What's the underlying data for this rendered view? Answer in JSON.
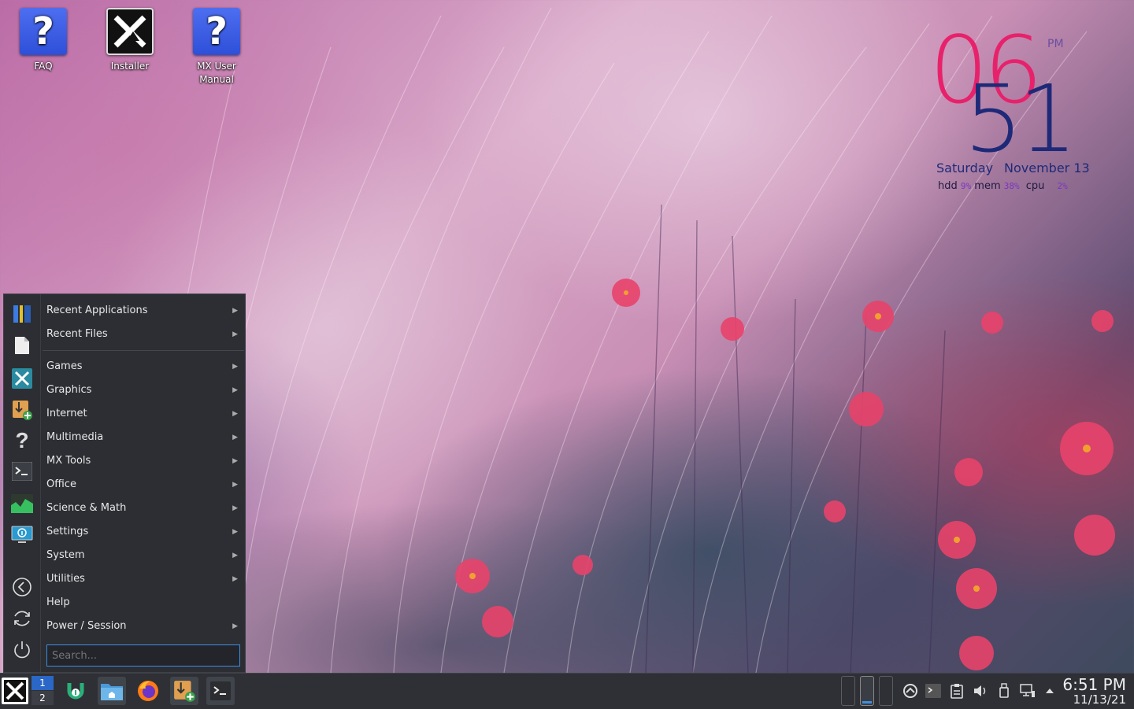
{
  "desktop": {
    "icons": [
      {
        "label": "FAQ"
      },
      {
        "label": "Installer"
      },
      {
        "label": "MX User Manual"
      }
    ]
  },
  "conky": {
    "hour": "06",
    "minute": "51",
    "ampm": "PM",
    "weekday": "Saturday",
    "date": "November 13",
    "hdd_label": "hdd",
    "hdd_value": "9%",
    "mem_label": "mem",
    "mem_value": "38%",
    "cpu_label": "cpu",
    "cpu_value": "2%"
  },
  "menu": {
    "items": [
      {
        "label": "Recent Applications",
        "submenu": true
      },
      {
        "label": "Recent Files",
        "submenu": true
      },
      {
        "label": "Games",
        "submenu": true
      },
      {
        "label": "Graphics",
        "submenu": true
      },
      {
        "label": "Internet",
        "submenu": true
      },
      {
        "label": "Multimedia",
        "submenu": true
      },
      {
        "label": "MX Tools",
        "submenu": true
      },
      {
        "label": "Office",
        "submenu": true
      },
      {
        "label": "Science & Math",
        "submenu": true
      },
      {
        "label": "Settings",
        "submenu": true
      },
      {
        "label": "System",
        "submenu": true
      },
      {
        "label": "Utilities",
        "submenu": true
      },
      {
        "label": "Help",
        "submenu": false
      },
      {
        "label": "Power / Session",
        "submenu": true
      }
    ],
    "search_placeholder": "Search...",
    "arrow_glyph": "▶"
  },
  "taskbar": {
    "pager": [
      "1",
      "2"
    ],
    "clock_time": "6:51 PM",
    "clock_date": "11/13/21"
  },
  "colors": {
    "accent": "#3d8ee0",
    "clock_hour": "#e8216b",
    "clock_minute": "#1e2a78"
  }
}
